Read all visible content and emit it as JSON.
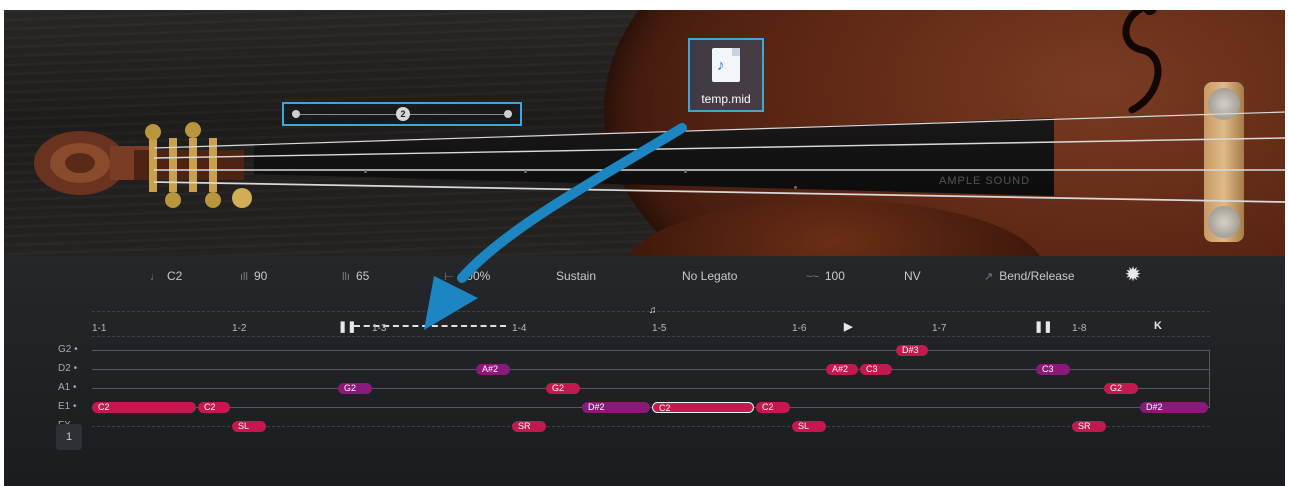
{
  "midi_file": {
    "name": "temp.mid",
    "icon": "midi-file-icon"
  },
  "capo_slider": {
    "value": "2"
  },
  "logo": "AMPLE SOUND",
  "params": {
    "note": "C2",
    "velocity": "90",
    "release_velocity": "65",
    "length": "100%",
    "articulation": "Sustain",
    "legato": "No Legato",
    "value_100": "100",
    "nv": "NV",
    "bend_release": "Bend/Release"
  },
  "tracks": [
    "G2",
    "D2",
    "A1",
    "E1",
    "FX"
  ],
  "bars": [
    "1-1",
    "1-2",
    "1-3",
    "1-4",
    "1-5",
    "1-6",
    "1-7",
    "1-8"
  ],
  "notes": {
    "g2": [
      "D#3"
    ],
    "d2": [
      "A#2",
      "A#2",
      "C3",
      "C3"
    ],
    "a1": [
      "G2",
      "G2",
      "G2"
    ],
    "e1": [
      "C2",
      "C2",
      "D#2",
      "C2",
      "C2",
      "D#2"
    ],
    "fx": [
      "SL",
      "SR",
      "SL",
      "SR"
    ]
  },
  "page": "1",
  "colors": {
    "note_red": "#c4194f",
    "note_purple": "#8a1a7a",
    "selection": "#3fa7d6",
    "arrow": "#1b86c2"
  }
}
